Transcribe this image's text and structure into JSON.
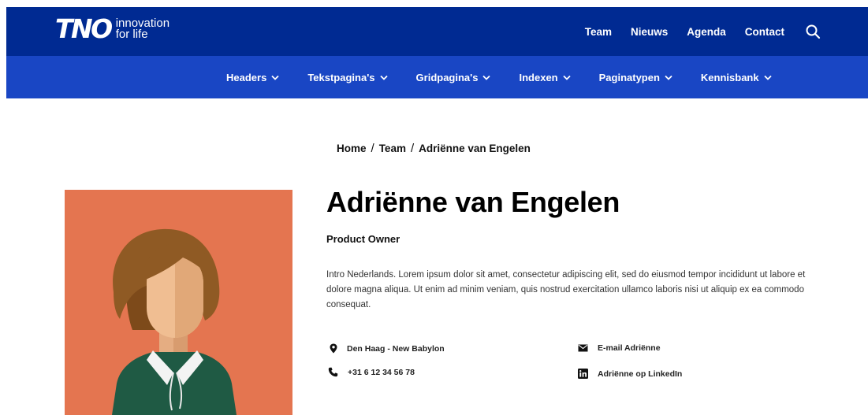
{
  "brand": {
    "logo_text": "TNO",
    "tagline": "innovation\nfor life",
    "primary_color": "#002a92",
    "secondary_color": "#1946c4",
    "portrait_background": "#e47550"
  },
  "top_nav": [
    "Team",
    "Nieuws",
    "Agenda",
    "Contact"
  ],
  "search_icon": "search-icon",
  "sub_nav": [
    "Headers",
    "Tekstpagina's",
    "Gridpagina's",
    "Indexen",
    "Paginatypen",
    "Kennisbank"
  ],
  "breadcrumb": {
    "items": [
      "Home",
      "Team",
      "Adriënne van Engelen"
    ],
    "separator": "/"
  },
  "profile": {
    "name": "Adriënne van Engelen",
    "role": "Product Owner",
    "intro": "Intro Nederlands. Lorem ipsum dolor sit amet, consectetur adipiscing elit, sed do eiusmod tempor incididunt ut labore et dolore magna aliqua. Ut enim ad minim veniam, quis nostrud exercitation ullamco laboris nisi ut aliquip ex ea commodo consequat.",
    "location": "Den Haag - New Babylon",
    "phone": "+31 6 12 34 56 78",
    "email_label": "E-mail Adriënne",
    "linkedin_label": "Adriënne op LinkedIn"
  }
}
